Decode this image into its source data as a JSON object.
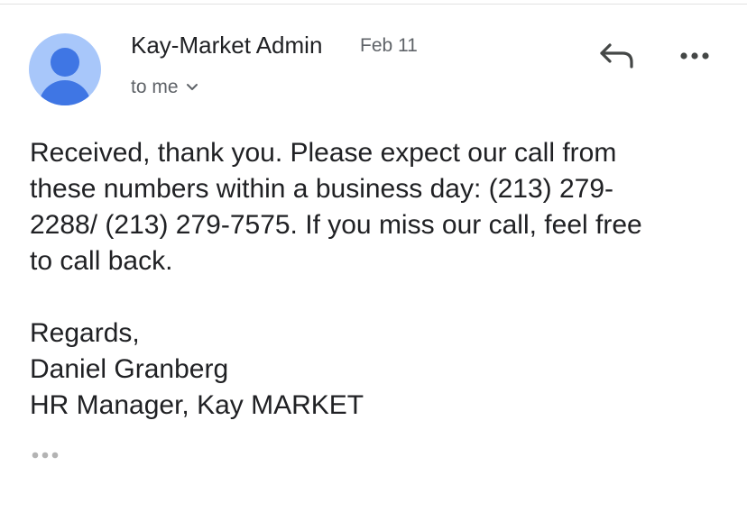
{
  "email": {
    "sender_name": "Kay-Market Admin",
    "date": "Feb 11",
    "recipient": "to me",
    "body_lines": [
      "Received, thank you.  Please expect our call from",
      "these numbers within a business day: (213) 279-",
      "2288/ (213) 279-7575. If you miss our call, feel free",
      "to call back."
    ],
    "signature_lines": [
      "Regards,",
      "Daniel Granberg",
      "HR Manager, Kay MARKET"
    ]
  },
  "icons": {
    "avatar": "person-icon",
    "recipient_toggle": "chevron-down-icon",
    "reply": "reply-icon",
    "more": "more-horizontal-icon",
    "trimmed_content": "ellipsis-icon"
  },
  "colors": {
    "avatar_background": "#a8c7fa",
    "avatar_figure": "#3f76e4",
    "secondary_text": "#5f6368"
  }
}
